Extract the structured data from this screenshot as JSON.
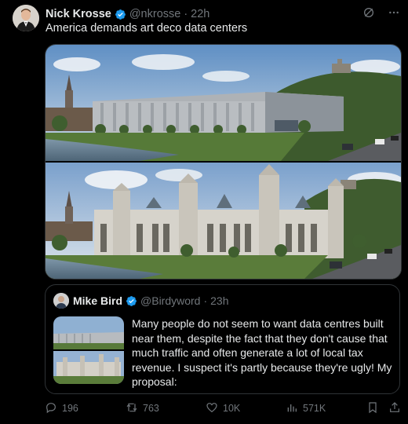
{
  "tweet": {
    "author_name": "Nick Krosse",
    "author_handle": "@nkrosse",
    "separator": "·",
    "time": "22h",
    "text": "America demands art deco data centers"
  },
  "quote": {
    "author_name": "Mike Bird",
    "author_handle": "@Birdyword",
    "separator": "·",
    "time": "23h",
    "text": "Many people do not seem to want data centres built near them, despite the fact that they don't cause that much traffic and often generate a lot of local tax revenue. I suspect it's partly because they're ugly! My proposal:"
  },
  "actions": {
    "replies": "196",
    "reposts": "763",
    "likes": "10K",
    "views": "571K"
  },
  "icons": {
    "verified": "verified-badge-icon",
    "grok": "grok-icon",
    "more": "more-icon",
    "reply": "reply-icon",
    "repost": "repost-icon",
    "like": "heart-icon",
    "views": "views-icon",
    "bookmark": "bookmark-icon",
    "share": "share-icon"
  },
  "colors": {
    "background": "#000000",
    "text": "#e7e9ea",
    "muted": "#71767b",
    "verified": "#1d9bf0",
    "border": "#2f3336"
  }
}
